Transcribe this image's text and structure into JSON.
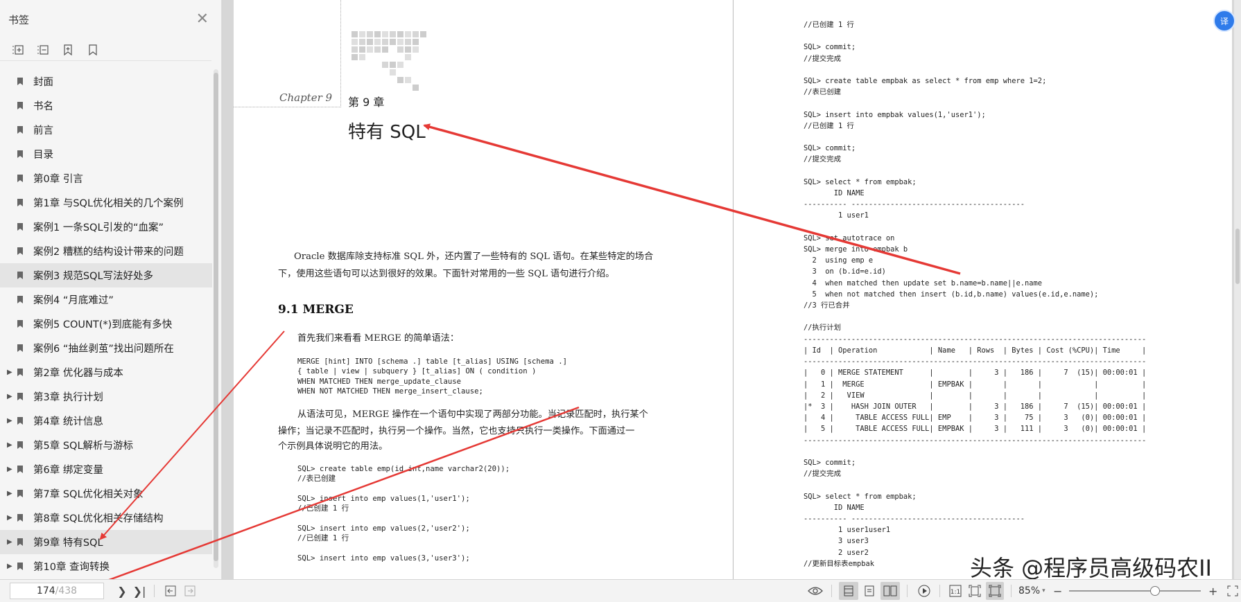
{
  "sidebar": {
    "title": "书签",
    "items": [
      {
        "label": "封面",
        "expandable": false,
        "selected": false
      },
      {
        "label": "书名",
        "expandable": false,
        "selected": false
      },
      {
        "label": "前言",
        "expandable": false,
        "selected": false
      },
      {
        "label": "目录",
        "expandable": false,
        "selected": false
      },
      {
        "label": "第0章 引言",
        "expandable": false,
        "selected": false
      },
      {
        "label": "第1章 与SQL优化相关的几个案例",
        "expandable": false,
        "selected": false
      },
      {
        "label": "案例1 一条SQL引发的“血案”",
        "expandable": false,
        "selected": false
      },
      {
        "label": "案例2 糟糕的结构设计带来的问题",
        "expandable": false,
        "selected": false
      },
      {
        "label": "案例3 规范SQL写法好处多",
        "expandable": false,
        "selected": true
      },
      {
        "label": "案例4 “月底难过”",
        "expandable": false,
        "selected": false
      },
      {
        "label": "案例5 COUNT(*)到底能有多快",
        "expandable": false,
        "selected": false
      },
      {
        "label": "案例6 “抽丝剥茧”找出问题所在",
        "expandable": false,
        "selected": false
      },
      {
        "label": "第2章 优化器与成本",
        "expandable": true,
        "selected": false
      },
      {
        "label": "第3章 执行计划",
        "expandable": true,
        "selected": false
      },
      {
        "label": "第4章 统计信息",
        "expandable": true,
        "selected": false
      },
      {
        "label": "第5章 SQL解析与游标",
        "expandable": true,
        "selected": false
      },
      {
        "label": "第6章 绑定变量",
        "expandable": true,
        "selected": false
      },
      {
        "label": "第7章 SQL优化相关对象",
        "expandable": true,
        "selected": false
      },
      {
        "label": "第8章 SQL优化相关存储结构",
        "expandable": true,
        "selected": false
      },
      {
        "label": "第9章 特有SQL",
        "expandable": true,
        "selected": true
      },
      {
        "label": "第10章 查询转换",
        "expandable": true,
        "selected": false
      }
    ]
  },
  "left_page": {
    "chapter_script": "Chapter 9",
    "chapter_number": "第 9 章",
    "chapter_title": "特有 SQL",
    "intro_line1": "Oracle 数据库除支持标准 SQL 外，还内置了一些特有的 SQL 语句。在某些特定的场合",
    "intro_line2": "下，使用这些语句可以达到很好的效果。下面针对常用的一些 SQL 语句进行介绍。",
    "section_heading": "9.1    MERGE",
    "syntax_intro": "首先我们来看看 MERGE 的简单语法：",
    "syntax_code": "MERGE [hint] INTO [schema .] table [t_alias] USING [schema .]\n{ table | view | subquery } [t_alias] ON ( condition )\nWHEN MATCHED THEN merge_update_clause\nWHEN NOT MATCHED THEN merge_insert_clause;",
    "explain_line1": "从语法可见，MERGE 操作在一个语句中实现了两部分功能。当记录匹配时，执行某个",
    "explain_line2": "操作；当记录不匹配时，执行另一个操作。当然，它也支持只执行一类操作。下面通过一",
    "explain_line3": "个示例具体说明它的用法。",
    "example_code": "SQL> create table emp(id int,name varchar2(20));\n//表已创建\n\nSQL> insert into emp values(1,'user1');\n//已创建 1 行\n\nSQL> insert into emp values(2,'user2');\n//已创建 1 行\n\nSQL> insert into emp values(3,'user3');"
  },
  "right_page": {
    "code": "//已创建 1 行\n\nSQL> commit;\n//提交完成\n\nSQL> create table empbak as select * from emp where 1=2;\n//表已创建\n\nSQL> insert into empbak values(1,'user1');\n//已创建 1 行\n\nSQL> commit;\n//提交完成\n\nSQL> select * from empbak;\n       ID NAME\n---------- ----------------------------------------\n        1 user1\n\nSQL> set autotrace on\nSQL> merge into empbak b\n  2  using emp e\n  3  on (b.id=e.id)\n  4  when matched then update set b.name=b.name||e.name\n  5  when not matched then insert (b.id,b.name) values(e.id,e.name);\n//3 行已合并\n\n//执行计划\n-------------------------------------------------------------------------------\n| Id  | Operation            | Name   | Rows  | Bytes | Cost (%CPU)| Time     |\n-------------------------------------------------------------------------------\n|   0 | MERGE STATEMENT      |        |     3 |   186 |     7  (15)| 00:00:01 |\n|   1 |  MERGE               | EMPBAK |       |       |            |          |\n|   2 |   VIEW               |        |       |       |            |          |\n|*  3 |    HASH JOIN OUTER   |        |     3 |   186 |     7  (15)| 00:00:01 |\n|   4 |     TABLE ACCESS FULL| EMP    |     3 |    75 |     3   (0)| 00:00:01 |\n|   5 |     TABLE ACCESS FULL| EMPBAK |     3 |   111 |     3   (0)| 00:00:01 |\n-------------------------------------------------------------------------------\n\nSQL> commit;\n//提交完成\n\nSQL> select * from empbak;\n       ID NAME\n---------- ----------------------------------------\n        1 user1user1\n        3 user3\n        2 user2\n//更新目标表empbak"
  },
  "watermark": "头条 @程序员高级码农II",
  "translate_badge": "译",
  "statusbar": {
    "current_page": "174",
    "total_pages": "/438",
    "zoom": "85%"
  },
  "colors": {
    "arrow": "#e53935",
    "accent": "#2f7bea"
  }
}
